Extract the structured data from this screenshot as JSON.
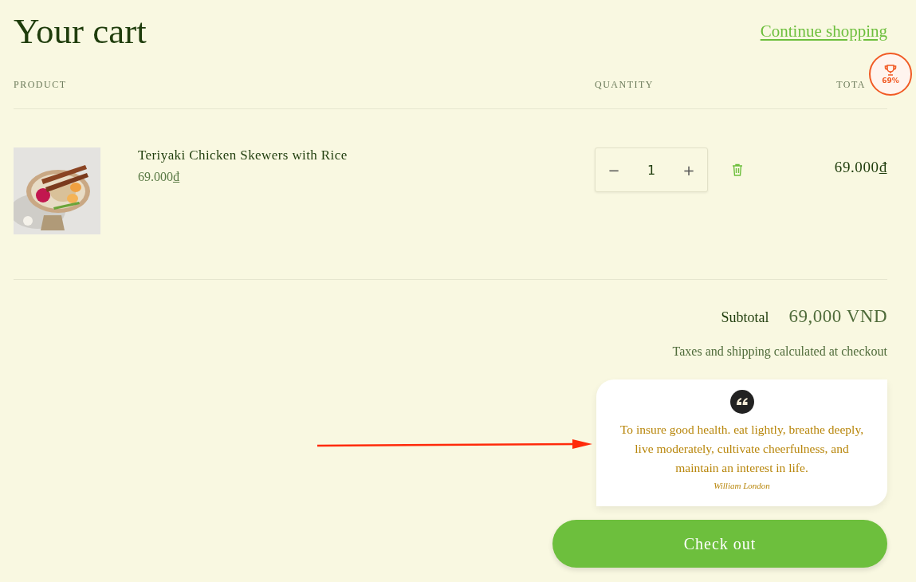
{
  "header": {
    "title": "Your cart",
    "link": "Continue shopping"
  },
  "columns": [
    "PRODUCT",
    "QUANTITY",
    "TOTA"
  ],
  "items": [
    {
      "kind": "picture",
      "name": "Teriyaki Chicken Skewers with Rice",
      "price": "69.000₫",
      "minus": "−",
      "quantity": "1",
      "plus": "+",
      "total": "69.000₫"
    }
  ],
  "badge": {
    "text": "69%"
  },
  "summary": {
    "subtotal_label": "Subtotal",
    "subtotal_value": "69,000 VND",
    "note": "Taxes and shipping calculated at checkout"
  },
  "quote": {
    "text": "To insure good health. eat lightly, breathe deeply, live moderately, cultivate cheerfulness, and maintain an interest in life.",
    "author": "William London"
  },
  "checkout_button": "Check out"
}
